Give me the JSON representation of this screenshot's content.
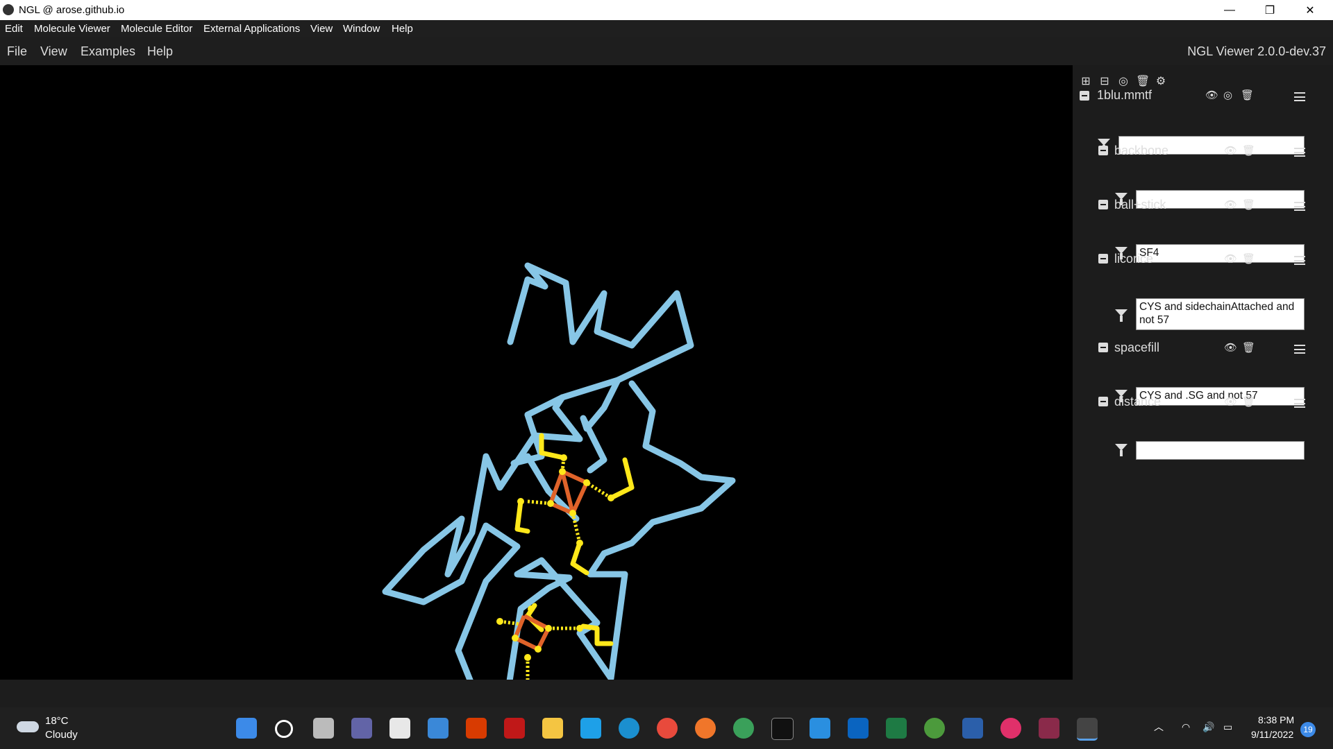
{
  "window": {
    "title": "NGL @ arose.github.io",
    "controls": {
      "minimize": "—",
      "restore": "❐",
      "close": "✕"
    }
  },
  "app_menu": [
    "Edit",
    "Molecule Viewer",
    "Molecule Editor",
    "External Applications",
    "View",
    "Window",
    "Help"
  ],
  "ngl_menu": {
    "items": [
      "File",
      "View",
      "Examples",
      "Help"
    ],
    "version": "NGL Viewer 2.0.0-dev.37"
  },
  "sidebar": {
    "toolbar_icons": [
      "add-icon",
      "collapse-icon",
      "center-icon",
      "delete-icon",
      "settings-icon"
    ],
    "component": {
      "name": "1blu.mmtf",
      "filter": ""
    },
    "representations": [
      {
        "name": "backbone",
        "filter": ""
      },
      {
        "name": "ball+stick",
        "filter": "SF4"
      },
      {
        "name": "licorice",
        "filter": "CYS and sidechainAttached and not 57"
      },
      {
        "name": "spacefill",
        "filter": "CYS and .SG and not 57"
      },
      {
        "name": "distance",
        "filter": ""
      }
    ]
  },
  "colors": {
    "backbone": "#87c6e6",
    "sulfur": "#ffe81a",
    "iron": "#e0632a",
    "sidebar_bg": "#1c1c1c",
    "taskbar_bg": "#202020"
  },
  "taskbar": {
    "weather_temp": "18°C",
    "weather_desc": "Cloudy",
    "time": "8:38 PM",
    "date": "9/11/2022",
    "notification_count": "19",
    "apps": [
      "start-icon",
      "search-icon",
      "task-view-icon",
      "chat-icon",
      "store-icon",
      "mail-icon",
      "office-icon",
      "mcafee-icon",
      "files-icon",
      "l-app-icon",
      "edge-icon",
      "chrome-icon",
      "firefox-icon",
      "chrome-icon",
      "terminal-icon",
      "vscode-icon",
      "outlook-icon",
      "excel-icon",
      "chrome-icon",
      "word-icon",
      "slack-icon",
      "winrar-icon",
      "ngl-app-icon"
    ]
  }
}
